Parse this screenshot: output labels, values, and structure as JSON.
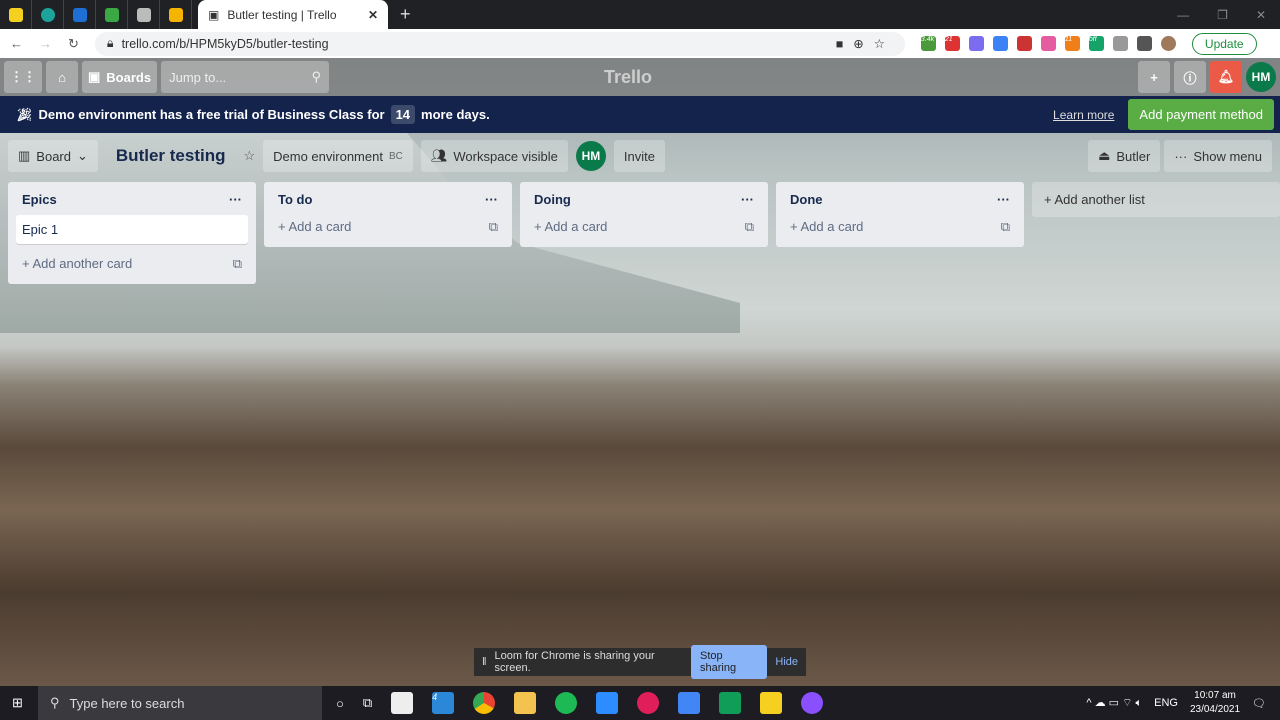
{
  "browser": {
    "tab_title": "Butler testing | Trello",
    "url": "trello.com/b/HPM5kyD5/butler-testing",
    "update_label": "Update",
    "ext_badges": [
      "3.4k",
      "21",
      "11",
      "off"
    ]
  },
  "nav": {
    "boards": "Boards",
    "jump_placeholder": "Jump to...",
    "logo": "Trello",
    "avatar": "HM"
  },
  "banner": {
    "text_before": "Demo environment has a free trial of Business Class for",
    "days": "14",
    "text_after": "more days.",
    "learn_more": "Learn more",
    "add_payment": "Add payment method"
  },
  "board": {
    "view": "Board",
    "title": "Butler testing",
    "workspace": "Demo environment",
    "workspace_badge": "BC",
    "visibility": "Workspace visible",
    "member": "HM",
    "invite": "Invite",
    "butler": "Butler",
    "show_menu": "Show menu"
  },
  "lists": [
    {
      "title": "Epics",
      "cards": [
        "Epic 1"
      ],
      "add": "Add another card"
    },
    {
      "title": "To do",
      "add": "Add a card"
    },
    {
      "title": "Doing",
      "add": "Add a card"
    },
    {
      "title": "Done",
      "add": "Add a card"
    }
  ],
  "add_list": "Add another list",
  "loom": {
    "text": "Loom for Chrome is sharing your screen.",
    "stop": "Stop sharing",
    "hide": "Hide"
  },
  "taskbar": {
    "search": "Type here to search",
    "lang": "ENG",
    "time": "10:07 am",
    "date": "23/04/2021",
    "badge": "4"
  },
  "colors": {
    "banner": "#14234b",
    "pay": "#5aac44",
    "avatar": "#0b7a4a",
    "bell": "#eb5a46"
  }
}
